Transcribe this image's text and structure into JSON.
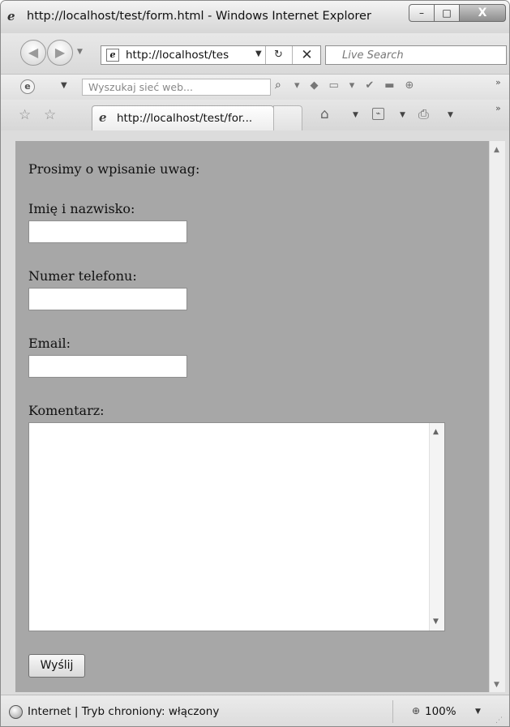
{
  "window": {
    "title": "http://localhost/test/form.html - Windows Internet Explorer",
    "controls": {
      "minimize": "–",
      "maximize": "□",
      "close": "X"
    }
  },
  "address_bar": {
    "url": "http://localhost/tes",
    "search_placeholder": "Live Search"
  },
  "toolbar": {
    "search_placeholder": "Wyszukaj sieć web..."
  },
  "tabs": [
    {
      "label": "http://localhost/test/for...",
      "active": true
    }
  ],
  "page": {
    "heading": "Prosimy o wpisanie uwag:",
    "fields": {
      "name_label": "Imię i nazwisko:",
      "phone_label": "Numer telefonu:",
      "email_label": "Email:",
      "comment_label": "Komentarz:"
    },
    "submit_label": "Wyślij",
    "background_color": "#a7a7a7"
  },
  "status_bar": {
    "text": "Internet | Tryb chroniony: włączony",
    "zoom": "100%"
  },
  "icons": [
    "ie-logo-icon",
    "back-icon",
    "forward-icon",
    "refresh-icon",
    "stop-icon",
    "search-icon",
    "favorites-star-icon",
    "add-favorites-icon",
    "home-icon",
    "feeds-icon",
    "print-icon",
    "globe-icon",
    "zoom-icon"
  ]
}
